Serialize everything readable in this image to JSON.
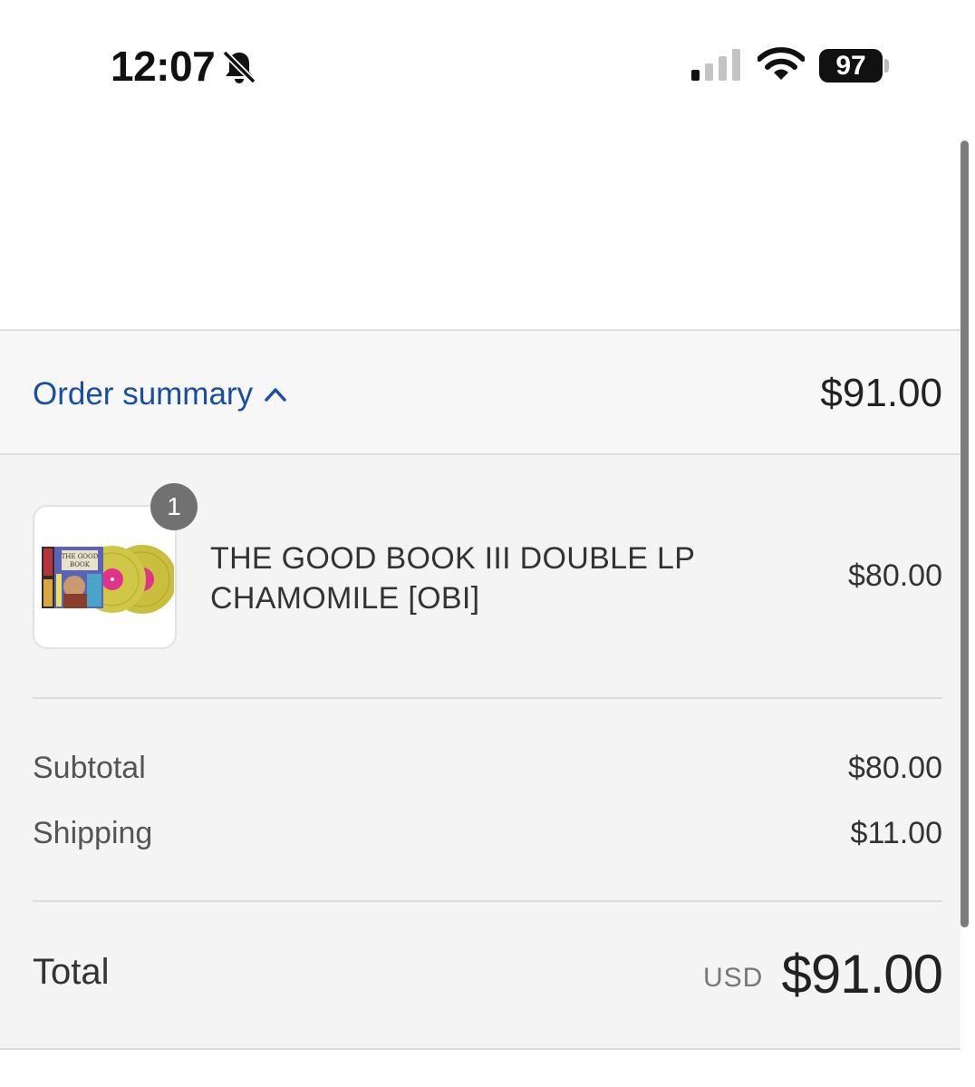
{
  "status_bar": {
    "time": "12:07",
    "battery": "97",
    "icons": [
      "bell-slash-icon",
      "cellular-signal-icon",
      "wifi-icon",
      "battery-icon"
    ]
  },
  "order_summary": {
    "toggle_label": "Order summary",
    "toggle_icon": "chevron-up-icon",
    "total": "$91.00",
    "accent_color": "#1a4fa0"
  },
  "item": {
    "quantity": "1",
    "name_line1": "THE GOOD BOOK III DOUBLE LP",
    "name_line2": "CHAMOMILE [OBI]",
    "price": "$80.00"
  },
  "costs": {
    "subtotal_label": "Subtotal",
    "subtotal_value": "$80.00",
    "shipping_label": "Shipping",
    "shipping_value": "$11.00"
  },
  "total": {
    "label": "Total",
    "currency": "USD",
    "value": "$91.00"
  }
}
